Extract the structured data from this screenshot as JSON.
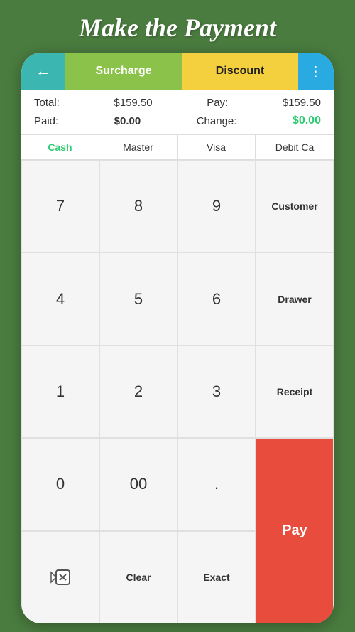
{
  "page": {
    "title": "Make the Payment"
  },
  "top_bar": {
    "back_label": "←",
    "surcharge_label": "Surcharge",
    "discount_label": "Discount",
    "more_label": "⋮"
  },
  "info": {
    "total_label": "Total:",
    "total_value": "$159.50",
    "pay_label": "Pay:",
    "pay_value": "$159.50",
    "paid_label": "Paid:",
    "paid_value": "$0.00",
    "change_label": "Change:",
    "change_value": "$0.00"
  },
  "payment_methods": [
    {
      "label": "Cash",
      "active": true
    },
    {
      "label": "Master",
      "active": false
    },
    {
      "label": "Visa",
      "active": false
    },
    {
      "label": "Debit Ca",
      "active": false
    }
  ],
  "keypad": {
    "rows": [
      [
        "7",
        "8",
        "9",
        "Customer"
      ],
      [
        "4",
        "5",
        "6",
        "Drawer"
      ],
      [
        "1",
        "2",
        "3",
        "Receipt"
      ],
      [
        "0",
        "00",
        ".",
        "Pay"
      ],
      [
        "⌫",
        "Clear",
        "Exact",
        ""
      ]
    ]
  },
  "colors": {
    "background": "#4a7c3f",
    "back_btn": "#3cb6b0",
    "surcharge_btn": "#8bc34a",
    "discount_btn": "#f4d03f",
    "more_btn": "#29abe2",
    "pay_key": "#e74c3c",
    "cash_active": "#2ecc71",
    "change_green": "#2ecc71"
  }
}
